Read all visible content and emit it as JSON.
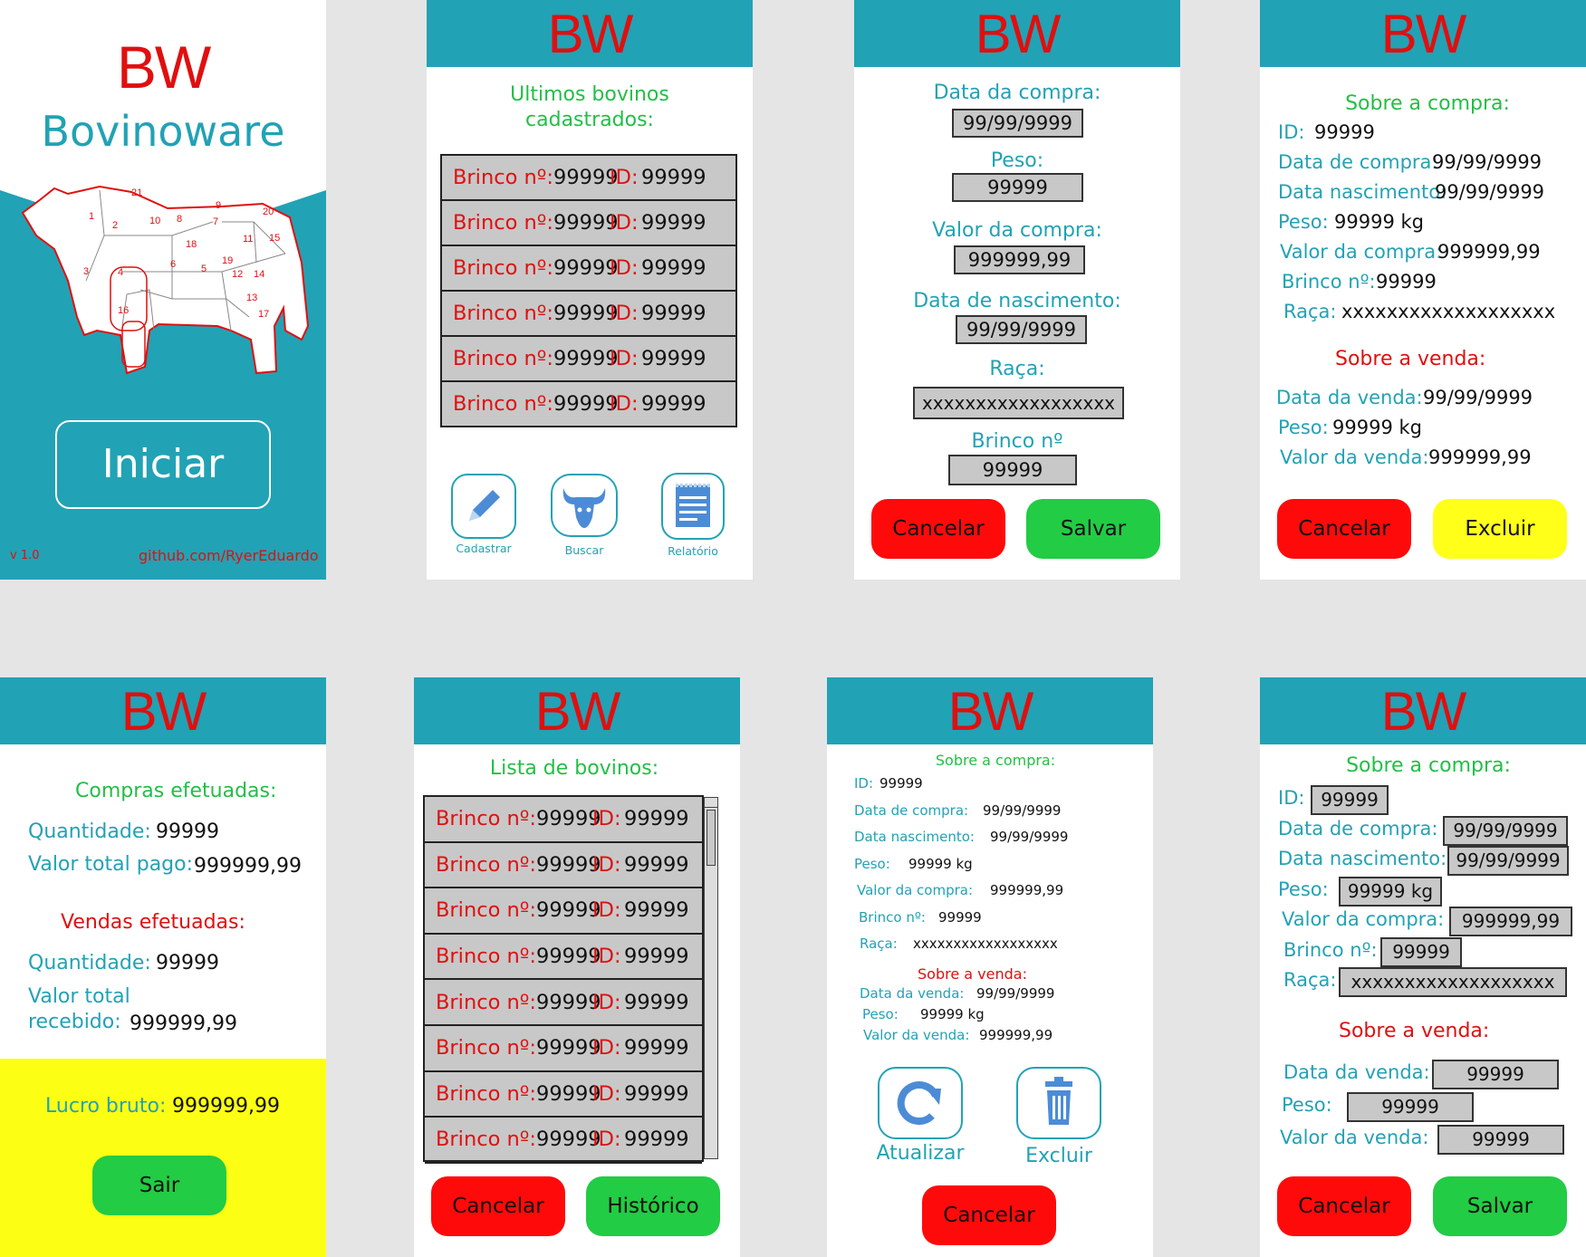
{
  "logo": "BW",
  "s1": {
    "title": "Bovinoware",
    "start_button": "Iniciar",
    "version": "v 1.0",
    "github": "github.com/RyerEduardo",
    "cut_numbers": [
      "21",
      "1",
      "2",
      "10",
      "8",
      "9",
      "7",
      "20",
      "18",
      "11",
      "15",
      "3",
      "4",
      "6",
      "5",
      "19",
      "12",
      "14",
      "13",
      "16",
      "17"
    ]
  },
  "s2": {
    "heading_line1": "Ultimos bovinos",
    "heading_line2": "cadastrados:",
    "rows": [
      {
        "brinco_label": "Brinco nº:",
        "brinco": "99999",
        "id_label": "ID:",
        "id": "99999"
      },
      {
        "brinco_label": "Brinco nº:",
        "brinco": "99999",
        "id_label": "ID:",
        "id": "99999"
      },
      {
        "brinco_label": "Brinco nº:",
        "brinco": "99999",
        "id_label": "ID:",
        "id": "99999"
      },
      {
        "brinco_label": "Brinco nº:",
        "brinco": "99999",
        "id_label": "ID:",
        "id": "99999"
      },
      {
        "brinco_label": "Brinco nº:",
        "brinco": "99999",
        "id_label": "ID:",
        "id": "99999"
      },
      {
        "brinco_label": "Brinco nº:",
        "brinco": "99999",
        "id_label": "ID:",
        "id": "99999"
      }
    ],
    "actions": {
      "register": "Cadastrar",
      "search": "Buscar",
      "report": "Relatório"
    }
  },
  "s3": {
    "fields": [
      {
        "label": "Data da compra:",
        "value": "99/99/9999"
      },
      {
        "label": "Peso:",
        "value": "99999"
      },
      {
        "label": "Valor da compra:",
        "value": "999999,99"
      },
      {
        "label": "Data de nascimento:",
        "value": "99/99/9999"
      },
      {
        "label": "Raça:",
        "value": "xxxxxxxxxxxxxxxxxx"
      },
      {
        "label": "Brinco nº",
        "value": "99999"
      }
    ],
    "cancel": "Cancelar",
    "save": "Salvar"
  },
  "s4": {
    "purchase_heading": "Sobre a compra:",
    "purchase": [
      {
        "label": "ID:",
        "value": "99999"
      },
      {
        "label": "Data de compra:",
        "value": "99/99/9999"
      },
      {
        "label": "Data nascimento:",
        "value": "99/99/9999"
      },
      {
        "label": "Peso:",
        "value": "99999 kg"
      },
      {
        "label": "Valor da compra:",
        "value": "999999,99"
      },
      {
        "label": "Brinco nº:",
        "value": "99999"
      },
      {
        "label": "Raça:",
        "value": "xxxxxxxxxxxxxxxxxxx"
      }
    ],
    "sale_heading": "Sobre a venda:",
    "sale": [
      {
        "label": "Data da venda:",
        "value": "99/99/9999"
      },
      {
        "label": "Peso:",
        "value": "99999 kg"
      },
      {
        "label": "Valor da venda:",
        "value": "999999,99"
      }
    ],
    "cancel": "Cancelar",
    "delete": "Excluir"
  },
  "s5": {
    "purchases_heading": "Compras efetuadas:",
    "purchase_qty_label": "Quantidade:",
    "purchase_qty": "99999",
    "purchase_total_label": "Valor total pago:",
    "purchase_total": "999999,99",
    "sales_heading": "Vendas efetuadas:",
    "sale_qty_label": "Quantidade:",
    "sale_qty": "99999",
    "sale_total_label1": "Valor total",
    "sale_total_label2": "recebido:",
    "sale_total": "999999,99",
    "profit_label": "Lucro bruto:",
    "profit": "999999,99",
    "exit": "Sair"
  },
  "s6": {
    "heading": "Lista de bovinos:",
    "rows": [
      {
        "brinco_label": "Brinco nº:",
        "brinco": "99999",
        "id_label": "ID:",
        "id": "99999"
      },
      {
        "brinco_label": "Brinco nº:",
        "brinco": "99999",
        "id_label": "ID:",
        "id": "99999"
      },
      {
        "brinco_label": "Brinco nº:",
        "brinco": "99999",
        "id_label": "ID:",
        "id": "99999"
      },
      {
        "brinco_label": "Brinco nº:",
        "brinco": "99999",
        "id_label": "ID:",
        "id": "99999"
      },
      {
        "brinco_label": "Brinco nº:",
        "brinco": "99999",
        "id_label": "ID:",
        "id": "99999"
      },
      {
        "brinco_label": "Brinco nº:",
        "brinco": "99999",
        "id_label": "ID:",
        "id": "99999"
      },
      {
        "brinco_label": "Brinco nº:",
        "brinco": "99999",
        "id_label": "ID:",
        "id": "99999"
      },
      {
        "brinco_label": "Brinco nº:",
        "brinco": "99999",
        "id_label": "ID:",
        "id": "99999"
      }
    ],
    "cancel": "Cancelar",
    "history": "Histórico"
  },
  "s7": {
    "purchase_heading": "Sobre a compra:",
    "purchase": [
      {
        "label": "ID:",
        "value": "99999"
      },
      {
        "label": "Data de compra:",
        "value": "99/99/9999"
      },
      {
        "label": "Data nascimento:",
        "value": "99/99/9999"
      },
      {
        "label": "Peso:",
        "value": "99999 kg"
      },
      {
        "label": "Valor da compra:",
        "value": "999999,99"
      },
      {
        "label": "Brinco nº:",
        "value": "99999"
      },
      {
        "label": "Raça:",
        "value": "xxxxxxxxxxxxxxxxxx"
      }
    ],
    "sale_heading": "Sobre a venda:",
    "sale": [
      {
        "label": "Data da venda:",
        "value": "99/99/9999"
      },
      {
        "label": "Peso:",
        "value": "99999 kg"
      },
      {
        "label": "Valor da venda:",
        "value": "999999,99"
      }
    ],
    "update": "Atualizar",
    "delete": "Excluir",
    "cancel": "Cancelar"
  },
  "s8": {
    "purchase_heading": "Sobre a compra:",
    "purchase": [
      {
        "label": "ID:",
        "value": "99999"
      },
      {
        "label": "Data de compra:",
        "value": "99/99/9999"
      },
      {
        "label": "Data nascimento:",
        "value": "99/99/9999"
      },
      {
        "label": "Peso:",
        "value": "99999 kg"
      },
      {
        "label": "Valor da compra:",
        "value": "999999,99"
      },
      {
        "label": "Brinco nº:",
        "value": "99999"
      },
      {
        "label": "Raça:",
        "value": "xxxxxxxxxxxxxxxxxxx"
      }
    ],
    "sale_heading": "Sobre a venda:",
    "sale": [
      {
        "label": "Data da venda:",
        "value": "99999"
      },
      {
        "label": "Peso:",
        "value": "99999"
      },
      {
        "label": "Valor da venda:",
        "value": "99999"
      }
    ],
    "cancel": "Cancelar",
    "save": "Salvar"
  }
}
